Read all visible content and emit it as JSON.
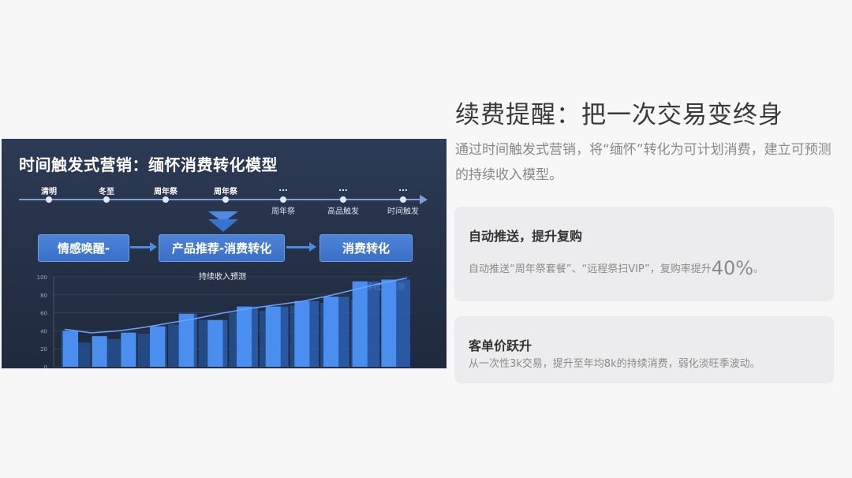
{
  "panel": {
    "title": "时间触发式营销：缅怀消费转化模型",
    "timeline": [
      {
        "top": "清明",
        "bottom": ""
      },
      {
        "top": "冬至",
        "bottom": ""
      },
      {
        "top": "周年祭",
        "bottom": ""
      },
      {
        "top": "周年祭",
        "bottom": ""
      },
      {
        "top": "...",
        "bottom": "周年祭"
      },
      {
        "top": "...",
        "bottom": "高品触发"
      },
      {
        "top": "...",
        "bottom": "时间触发"
      }
    ],
    "flow": [
      "情感唤醒-",
      "产品推荐-消费转化",
      "消费转化"
    ],
    "chart_caption_center": "持续收入预测",
    "chart_caption_right": "持续收入预测"
  },
  "chart_data": {
    "type": "bar",
    "ylim": [
      0,
      100
    ],
    "yticks": [
      "0",
      "20",
      "40",
      "60",
      "80",
      "100"
    ],
    "values": [
      40,
      27,
      34,
      31,
      38,
      37,
      45,
      47,
      59,
      52,
      52,
      60,
      67,
      62,
      67,
      68,
      73,
      71,
      78,
      75,
      95,
      88,
      97
    ],
    "highlight_values": [
      40,
      34,
      38,
      45,
      59,
      52,
      67,
      67,
      73,
      78,
      95,
      97
    ],
    "trend_line": [
      40,
      36,
      38,
      42,
      47,
      52,
      58,
      63,
      67,
      71,
      77,
      84,
      91,
      97
    ],
    "grid": true
  },
  "content": {
    "title": "续费提醒：把一次交易变终身",
    "subtitle": "通过时间触发式营销，将“缅怀”转化为可计划消费，建立可预测的持续收入模型。",
    "cards": [
      {
        "title": "自动推送，提升复购",
        "text_prefix": "自动推送“周年祭套餐”、“远程祭扫VIP”，复购率提升",
        "highlight": "40%",
        "text_suffix": "。"
      },
      {
        "title": "客单价跃升",
        "text": "从一次性3k交易，提升至年均8k的持续消费，弱化淡旺季波动。"
      }
    ]
  },
  "colors": {
    "panel_bg": "#263248",
    "bar": "#3f7fe0",
    "bar_highlight": "#2f6fd6",
    "accent": "#4f8ae0",
    "card_bg": "#ececee"
  }
}
